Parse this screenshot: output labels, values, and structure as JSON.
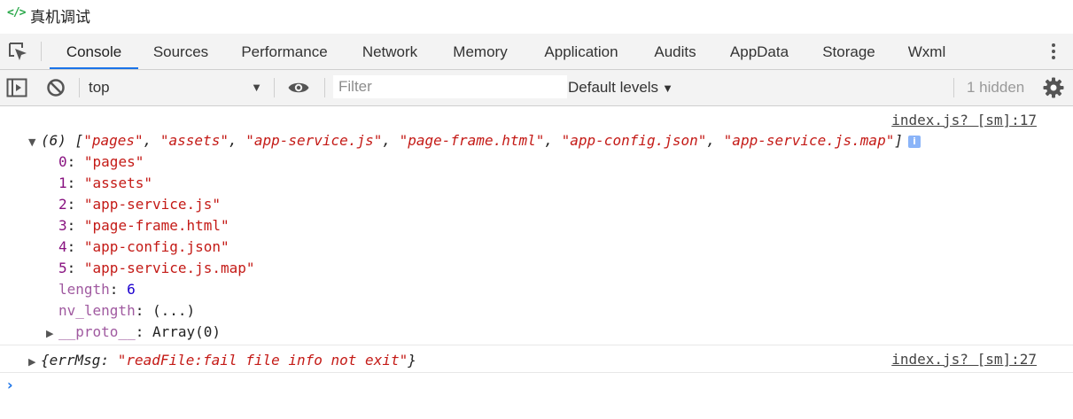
{
  "window": {
    "title": "真机调试",
    "icon": "code-brackets-icon"
  },
  "tabs": [
    {
      "label": "Console",
      "active": true
    },
    {
      "label": "Sources"
    },
    {
      "label": "Performance"
    },
    {
      "label": "Network"
    },
    {
      "label": "Memory"
    },
    {
      "label": "Application"
    },
    {
      "label": "Audits"
    },
    {
      "label": "AppData"
    },
    {
      "label": "Storage"
    },
    {
      "label": "Wxml"
    }
  ],
  "toolbar": {
    "context": "top",
    "filter_placeholder": "Filter",
    "levels": "Default levels",
    "hidden": "1 hidden"
  },
  "console": {
    "entry1": {
      "source": "index.js? [sm]:17",
      "summary_count": "(6)",
      "summary_items": [
        "\"pages\"",
        "\"assets\"",
        "\"app-service.js\"",
        "\"page-frame.html\"",
        "\"app-config.json\"",
        "\"app-service.js.map\""
      ],
      "info_badge": "i",
      "items": [
        {
          "key": "0",
          "value": "\"pages\""
        },
        {
          "key": "1",
          "value": "\"assets\""
        },
        {
          "key": "2",
          "value": "\"app-service.js\""
        },
        {
          "key": "3",
          "value": "\"page-frame.html\""
        },
        {
          "key": "4",
          "value": "\"app-config.json\""
        },
        {
          "key": "5",
          "value": "\"app-service.js.map\""
        }
      ],
      "length_key": "length",
      "length_value": "6",
      "nv_key": "nv_length",
      "nv_value": "(...)",
      "proto_key": "__proto__",
      "proto_value": "Array(0)"
    },
    "entry2": {
      "source": "index.js? [sm]:27",
      "key": "errMsg",
      "value": "\"readFile:fail file info not exit\""
    }
  },
  "colors": {
    "accent": "#1a73e8",
    "string": "#c41a16",
    "key": "#881280",
    "number": "#1c00cf"
  }
}
